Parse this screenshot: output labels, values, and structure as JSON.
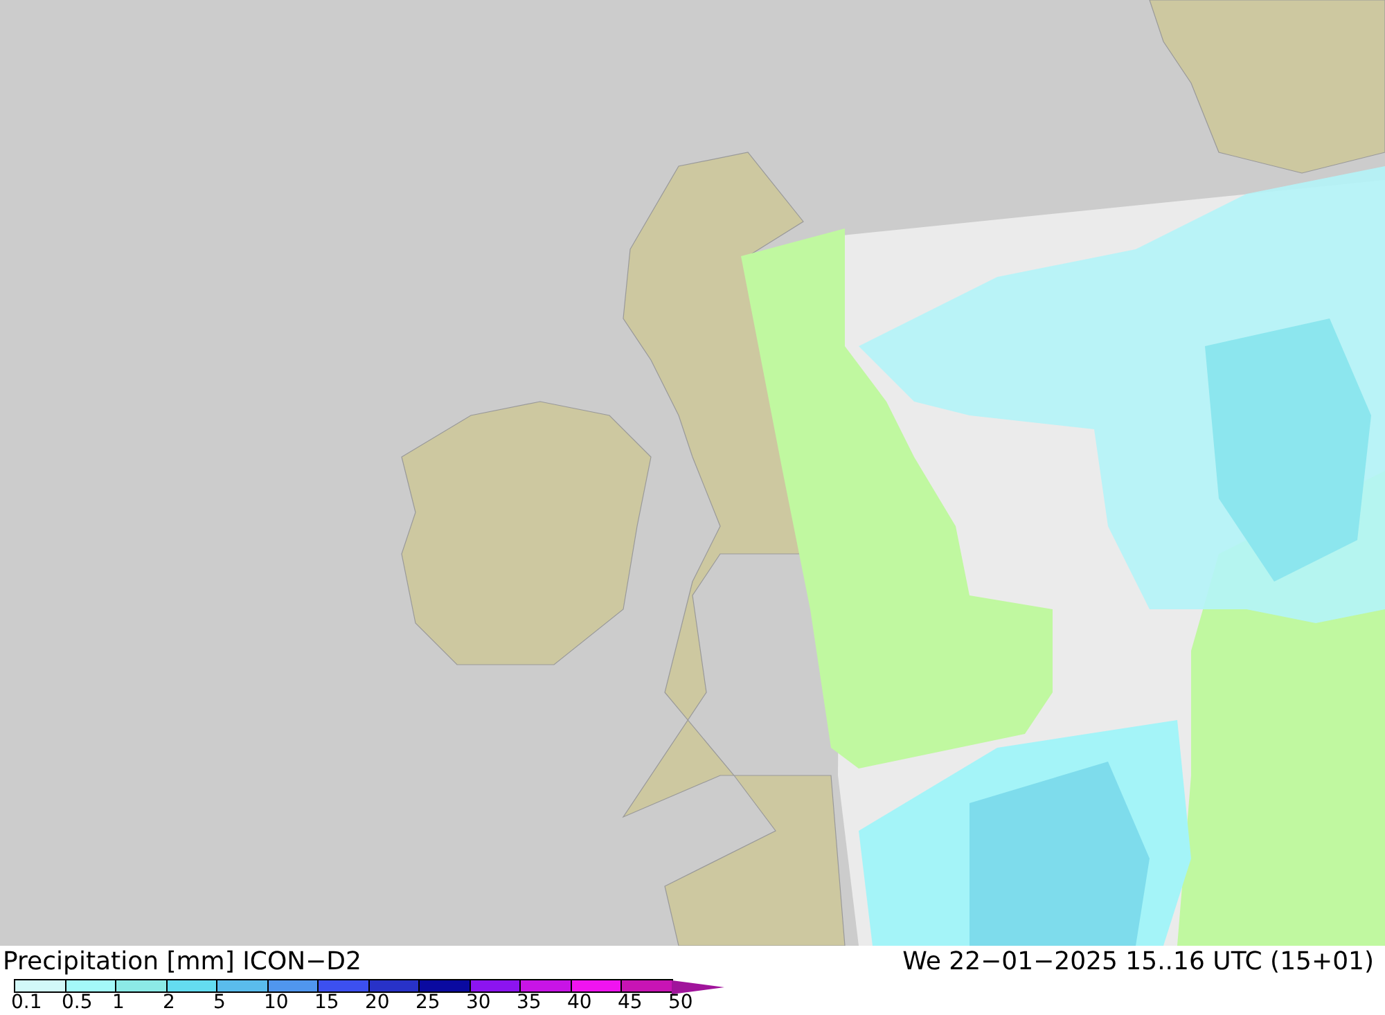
{
  "legend": {
    "title": "Precipitation [mm] ICON−D2",
    "timestamp": "We 22−01−2025 15..16 UTC (15+01)",
    "bins": [
      {
        "kind": "box",
        "label": "0.1",
        "color": "#d2f8f8"
      },
      {
        "kind": "box",
        "label": "0.5",
        "color": "#a4f8f8"
      },
      {
        "kind": "box",
        "label": "1",
        "color": "#8ceae6"
      },
      {
        "kind": "box",
        "label": "2",
        "color": "#64dcf0"
      },
      {
        "kind": "box",
        "label": "5",
        "color": "#5abcec"
      },
      {
        "kind": "box",
        "label": "10",
        "color": "#5096ee"
      },
      {
        "kind": "box",
        "label": "15",
        "color": "#3c50f0"
      },
      {
        "kind": "box",
        "label": "20",
        "color": "#2832c8"
      },
      {
        "kind": "box",
        "label": "25",
        "color": "#0a0aa0"
      },
      {
        "kind": "box",
        "label": "30",
        "color": "#8c14f0"
      },
      {
        "kind": "box",
        "label": "35",
        "color": "#c814e6"
      },
      {
        "kind": "box",
        "label": "40",
        "color": "#f014f0"
      },
      {
        "kind": "box",
        "label": "45",
        "color": "#c814b4"
      },
      {
        "kind": "arrow",
        "label": "50",
        "color": "#a0149b"
      }
    ]
  }
}
